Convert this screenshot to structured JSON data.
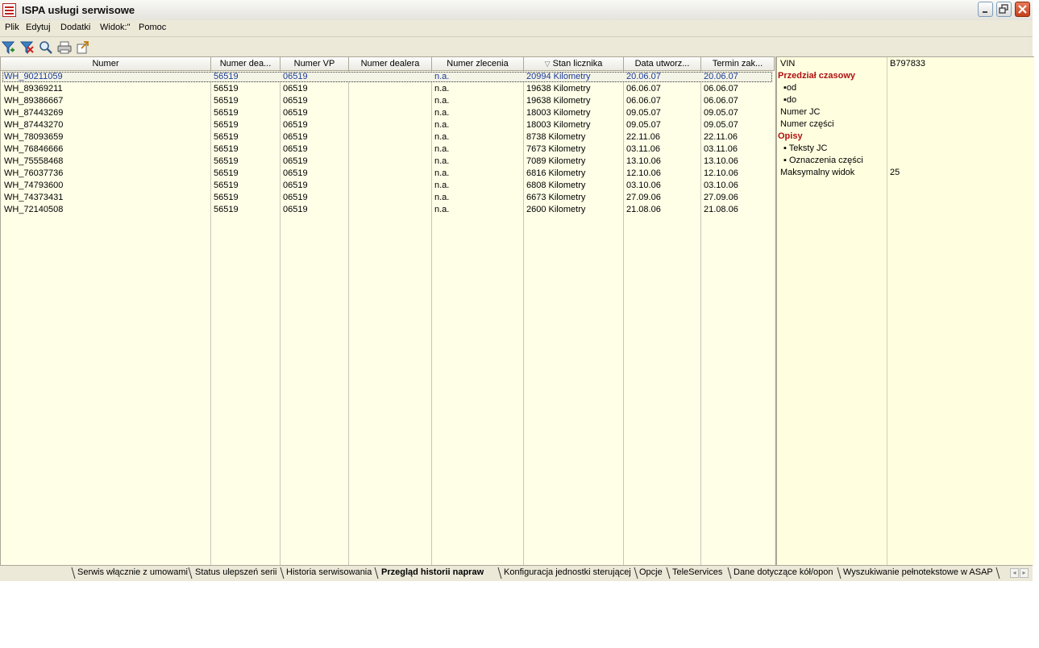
{
  "window": {
    "title": "ISPA usługi serwisowe"
  },
  "menu": [
    "Plik",
    "Edytuj",
    "Dodatki",
    "Widok:\"",
    "Pomoc"
  ],
  "toolbar": {
    "icons": [
      "filter-icon",
      "clear-filter-icon",
      "search-icon",
      "print-icon",
      "export-icon"
    ]
  },
  "grid": {
    "columns": [
      "Numer",
      "Numer dea...",
      "Numer VP",
      "Numer dealera",
      "Numer zlecenia",
      "Stan licznika",
      "Data utworz...",
      "Termin zak..."
    ],
    "sort_indicator": "▽",
    "selected_row": 0,
    "rows": [
      [
        "WH_90211059",
        "56519",
        "06519",
        "",
        "n.a.",
        "20994 Kilometry",
        "20.06.07",
        "20.06.07"
      ],
      [
        "WH_89369211",
        "56519",
        "06519",
        "",
        "n.a.",
        "19638 Kilometry",
        "06.06.07",
        "06.06.07"
      ],
      [
        "WH_89386667",
        "56519",
        "06519",
        "",
        "n.a.",
        "19638 Kilometry",
        "06.06.07",
        "06.06.07"
      ],
      [
        "WH_87443269",
        "56519",
        "06519",
        "",
        "n.a.",
        "18003 Kilometry",
        "09.05.07",
        "09.05.07"
      ],
      [
        "WH_87443270",
        "56519",
        "06519",
        "",
        "n.a.",
        "18003 Kilometry",
        "09.05.07",
        "09.05.07"
      ],
      [
        "WH_78093659",
        "56519",
        "06519",
        "",
        "n.a.",
        "8738 Kilometry",
        "22.11.06",
        "22.11.06"
      ],
      [
        "WH_76846666",
        "56519",
        "06519",
        "",
        "n.a.",
        "7673 Kilometry",
        "03.11.06",
        "03.11.06"
      ],
      [
        "WH_75558468",
        "56519",
        "06519",
        "",
        "n.a.",
        "7089 Kilometry",
        "13.10.06",
        "13.10.06"
      ],
      [
        "WH_76037736",
        "56519",
        "06519",
        "",
        "n.a.",
        "6816 Kilometry",
        "12.10.06",
        "12.10.06"
      ],
      [
        "WH_74793600",
        "56519",
        "06519",
        "",
        "n.a.",
        "6808 Kilometry",
        "03.10.06",
        "03.10.06"
      ],
      [
        "WH_74373431",
        "56519",
        "06519",
        "",
        "n.a.",
        "6673 Kilometry",
        "27.09.06",
        "27.09.06"
      ],
      [
        "WH_72140508",
        "56519",
        "06519",
        "",
        "n.a.",
        "2600 Kilometry",
        "21.08.06",
        "21.08.06"
      ]
    ]
  },
  "properties": {
    "vin_label": "VIN",
    "vin_value": "B797833",
    "cat_time": "Przedział czasowy",
    "od": "od",
    "do": "do",
    "numer_jc": "Numer JC",
    "numer_czesci": "Numer części",
    "cat_opisy": "Opisy",
    "teksty_jc": "Teksty JC",
    "oznaczenia": "Oznaczenia części",
    "max_label": "Maksymalny widok",
    "max_value": "25"
  },
  "tabs": [
    "Serwis włącznie z umowami",
    "Status ulepszeń serii",
    "Historia serwisowania",
    "Przegląd historii napraw",
    "Konfiguracja jednostki sterującej",
    "Opcje",
    "TeleServices",
    "Dane dotyczące kół/opon",
    "Wyszukiwanie pełnotekstowe w ASAP"
  ],
  "active_tab": 3
}
